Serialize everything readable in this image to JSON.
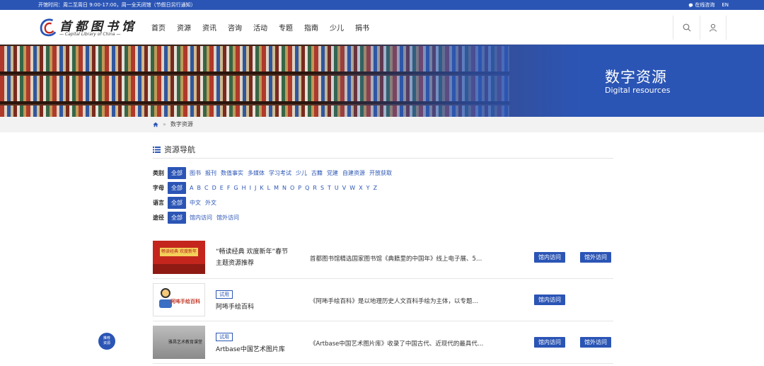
{
  "topbar": {
    "hours": "开馆时间：周二至周日 9:00-17:00，周一全天闭馆（节假日另行通知）",
    "chat": "在线咨询",
    "lang": "EN"
  },
  "logo": {
    "cn": "首都图书馆",
    "en": "— Capital Library of China —"
  },
  "nav": [
    "首页",
    "资源",
    "资讯",
    "咨询",
    "活动",
    "专题",
    "指南",
    "少儿",
    "捐书"
  ],
  "banner": {
    "title": "数字资源",
    "subtitle": "Digital resources"
  },
  "breadcrumb": {
    "current": "数字资源"
  },
  "section": {
    "title": "资源导航"
  },
  "filters": {
    "all_label": "全部",
    "category": {
      "label": "类别",
      "options": [
        "图书",
        "报刊",
        "数值事实",
        "多媒体",
        "学习考试",
        "少儿",
        "古籍",
        "党建",
        "自建资源",
        "开放获取"
      ]
    },
    "letter": {
      "label": "字母",
      "options": [
        "A",
        "B",
        "C",
        "D",
        "E",
        "F",
        "G",
        "H",
        "I",
        "J",
        "K",
        "L",
        "M",
        "N",
        "O",
        "P",
        "Q",
        "R",
        "S",
        "T",
        "U",
        "V",
        "W",
        "X",
        "Y",
        "Z"
      ]
    },
    "language": {
      "label": "语言",
      "options": [
        "中文",
        "外文"
      ]
    },
    "access": {
      "label": "途径",
      "options": [
        "馆内访问",
        "馆外访问"
      ]
    }
  },
  "resources": [
    {
      "thumb_text": "畅读经典 欢度新年",
      "name_line1": "“畅读经典 欢度新年”春节",
      "name_line2": "主题资源推荐",
      "trial": "",
      "desc": "首都图书馆精选国家图书馆《典籍里的中国年》线上电子展、5…",
      "btn_in": "馆内访问",
      "btn_out": "馆外访问"
    },
    {
      "thumb_text": "阿咘手绘百科",
      "name_line1": "阿咘手绘百科",
      "trial": "试用",
      "desc": "《阿咘手绘百科》是以地理历史人文百科手绘为主体，以专题…",
      "btn_in": "馆内访问",
      "btn_out": ""
    },
    {
      "thumb_text": "雅昌艺术教育课堂",
      "name_line1": "Artbase中国艺术图片库",
      "trial": "试用",
      "desc": "《Artbase中国艺术图片库》收录了中国古代、近现代的最具代…",
      "btn_in": "馆内访问",
      "btn_out": "馆外访问"
    }
  ],
  "float_button": {
    "line1": "推荐",
    "line2": "资源"
  },
  "colors": {
    "brand": "#2b55b5"
  }
}
